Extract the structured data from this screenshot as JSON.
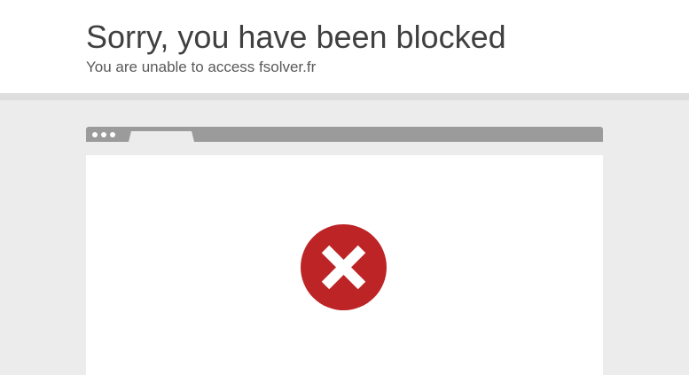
{
  "header": {
    "title": "Sorry, you have been blocked",
    "subtitle": "You are unable to access fsolver.fr"
  },
  "browser_illustration": {
    "window_dots": 3,
    "icon": "error-x-icon"
  },
  "colors": {
    "title_text": "#404040",
    "subtitle_text": "#595959",
    "background_gray": "#ececec",
    "divider_gray": "#dedede",
    "browser_bar": "#9b9b9b",
    "error_red": "#bd2426",
    "error_x": "#ffffff"
  }
}
